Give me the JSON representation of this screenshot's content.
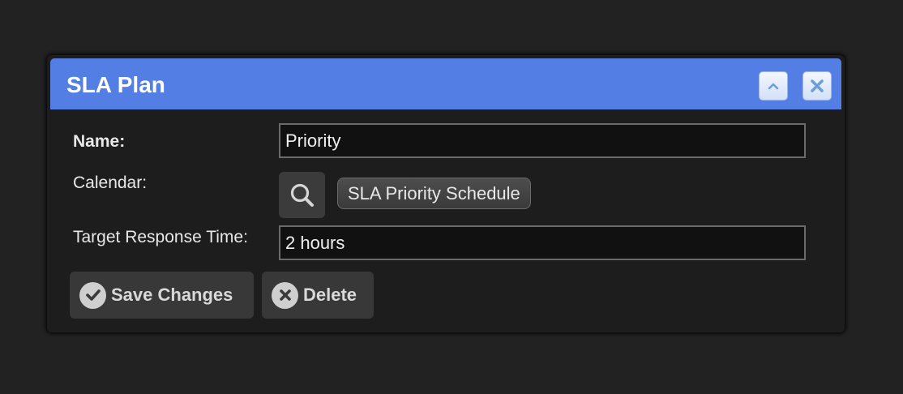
{
  "dialog": {
    "title": "SLA Plan",
    "title_buttons": [
      {
        "icon": "chevron-up-icon"
      },
      {
        "icon": "close-icon"
      }
    ]
  },
  "form": {
    "name_label": "Name:",
    "name_value": "Priority",
    "calendar_label": "Calendar:",
    "calendar_value": "SLA Priority Schedule",
    "target_label": "Target Response Time:",
    "target_value": "2 hours"
  },
  "actions": {
    "save_label": "Save Changes",
    "delete_label": "Delete"
  },
  "colors": {
    "accent": "#537ee3",
    "background": "#222222",
    "panel": "#1d1d1d"
  }
}
